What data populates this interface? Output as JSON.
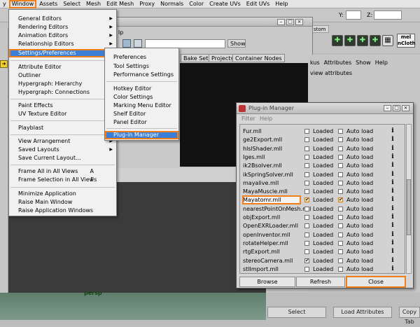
{
  "menubar": {
    "items": [
      "y",
      "Window",
      "Assets",
      "Select",
      "Mesh",
      "Edit Mesh",
      "Proxy",
      "Normals",
      "Color",
      "Create UVs",
      "Edit UVs",
      "Help"
    ]
  },
  "status": {
    "y_label": "Y:",
    "z_label": "Z:"
  },
  "shelf": {
    "tab_left": "ks",
    "tab_right": "stom",
    "mel_label": "mel",
    "ncloth_label": "nCloth"
  },
  "bg_panel": {
    "menu_help": "lp",
    "show_button": "Show",
    "tabs": [
      "Bake Sets",
      "Projects",
      "Container Nodes"
    ]
  },
  "right_panel": {
    "menu": [
      "kus",
      "Attributes",
      "Show",
      "Help"
    ],
    "text": "view attributes",
    "select_button": "Select",
    "load_attributes_button": "Load Attributes",
    "copy_tab_button": "Copy Tab"
  },
  "viewport": {
    "label": "persp"
  },
  "window_menu": {
    "items": [
      {
        "label": "General Editors",
        "sub": true
      },
      {
        "label": "Rendering Editors",
        "sub": true
      },
      {
        "label": "Animation Editors",
        "sub": true
      },
      {
        "label": "Relationship Editors",
        "sub": true
      },
      {
        "label": "Settings/Preferences",
        "sub": true
      },
      {
        "label": "Attribute Editor"
      },
      {
        "label": "Outliner"
      },
      {
        "label": "Hypergraph: Hierarchy"
      },
      {
        "label": "Hypergraph: Connections"
      },
      {
        "label": "Paint Effects"
      },
      {
        "label": "UV Texture Editor"
      },
      {
        "label": "Playblast"
      },
      {
        "label": "View Arrangement",
        "sub": true
      },
      {
        "label": "Saved Layouts",
        "sub": true
      },
      {
        "label": "Save Current Layout..."
      },
      {
        "label": "Frame All in All Views",
        "accel": "A"
      },
      {
        "label": "Frame Selection in All Views",
        "accel": "F"
      },
      {
        "label": "Minimize Application"
      },
      {
        "label": "Raise Main Window"
      },
      {
        "label": "Raise Application Windows"
      }
    ]
  },
  "settings_submenu": {
    "items": [
      "Preferences",
      "Tool Settings",
      "Performance Settings",
      "Hotkey Editor",
      "Color Settings",
      "Marking Menu Editor",
      "Shelf Editor",
      "Panel Editor",
      "Plug-in Manager"
    ]
  },
  "plugin_manager": {
    "title": "Plug-in Manager",
    "menus": [
      "Filter",
      "Help"
    ],
    "loaded_label": "Loaded",
    "autoload_label": "Auto load",
    "info_glyph": "i",
    "plugins": [
      {
        "name": "Fur.mll",
        "loaded": false,
        "autoload": false
      },
      {
        "name": "ge2Export.mll",
        "loaded": false,
        "autoload": false
      },
      {
        "name": "hlslShader.mll",
        "loaded": false,
        "autoload": false
      },
      {
        "name": "Iges.mll",
        "loaded": false,
        "autoload": false
      },
      {
        "name": "ik2Bsolver.mll",
        "loaded": false,
        "autoload": false
      },
      {
        "name": "ikSpringSolver.mll",
        "loaded": false,
        "autoload": false
      },
      {
        "name": "mayalive.mll",
        "loaded": false,
        "autoload": false
      },
      {
        "name": "MayaMuscle.mll",
        "loaded": false,
        "autoload": false
      },
      {
        "name": "Mayatomr.mll",
        "loaded": true,
        "autoload": true
      },
      {
        "name": "nearestPointOnMesh.mll",
        "loaded": false,
        "autoload": false
      },
      {
        "name": "objExport.mll",
        "loaded": false,
        "autoload": false
      },
      {
        "name": "OpenEXRLoader.mll",
        "loaded": false,
        "autoload": false
      },
      {
        "name": "openInventor.mll",
        "loaded": false,
        "autoload": false
      },
      {
        "name": "rotateHelper.mll",
        "loaded": false,
        "autoload": false
      },
      {
        "name": "rtgExport.mll",
        "loaded": false,
        "autoload": false
      },
      {
        "name": "stereoCamera.mll",
        "loaded": true,
        "autoload": false
      },
      {
        "name": "stlImport.mll",
        "loaded": false,
        "autoload": false
      }
    ],
    "browse_button": "Browse",
    "refresh_button": "Refresh",
    "close_button": "Close"
  },
  "colors": {
    "highlight": "#3a7fd5",
    "callout": "#ee7f1a"
  }
}
